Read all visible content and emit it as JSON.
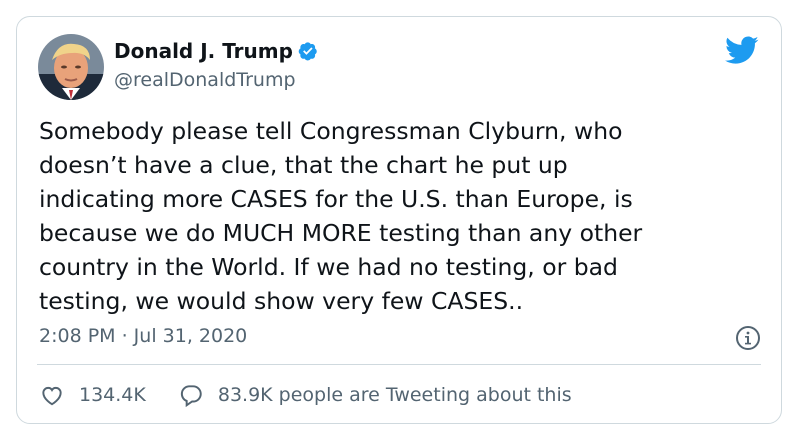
{
  "author": {
    "display_name": "Donald J. Trump",
    "handle": "@realDonaldTrump",
    "verified": true,
    "avatar_icon": "profile-photo",
    "brand_color": "#1d9bf0"
  },
  "tweet": {
    "lines": [
      "Somebody please tell Congressman Clyburn, who",
      "doesn’t have a clue, that the chart he put up",
      "indicating more CASES for the U.S. than Europe, is",
      "because we do MUCH MORE testing than any other",
      "country in the World. If we had no testing, or bad",
      "testing, we would show very few CASES.."
    ],
    "timestamp": "2:08 PM · Jul 31, 2020"
  },
  "stats": {
    "likes": "134.4K",
    "replies_label": "83.9K people are Tweeting about this"
  },
  "icons": {
    "twitter": "twitter-bird-icon",
    "info": "info-icon",
    "like": "heart-icon",
    "reply": "reply-bubble-icon",
    "verified": "verified-badge-icon"
  }
}
